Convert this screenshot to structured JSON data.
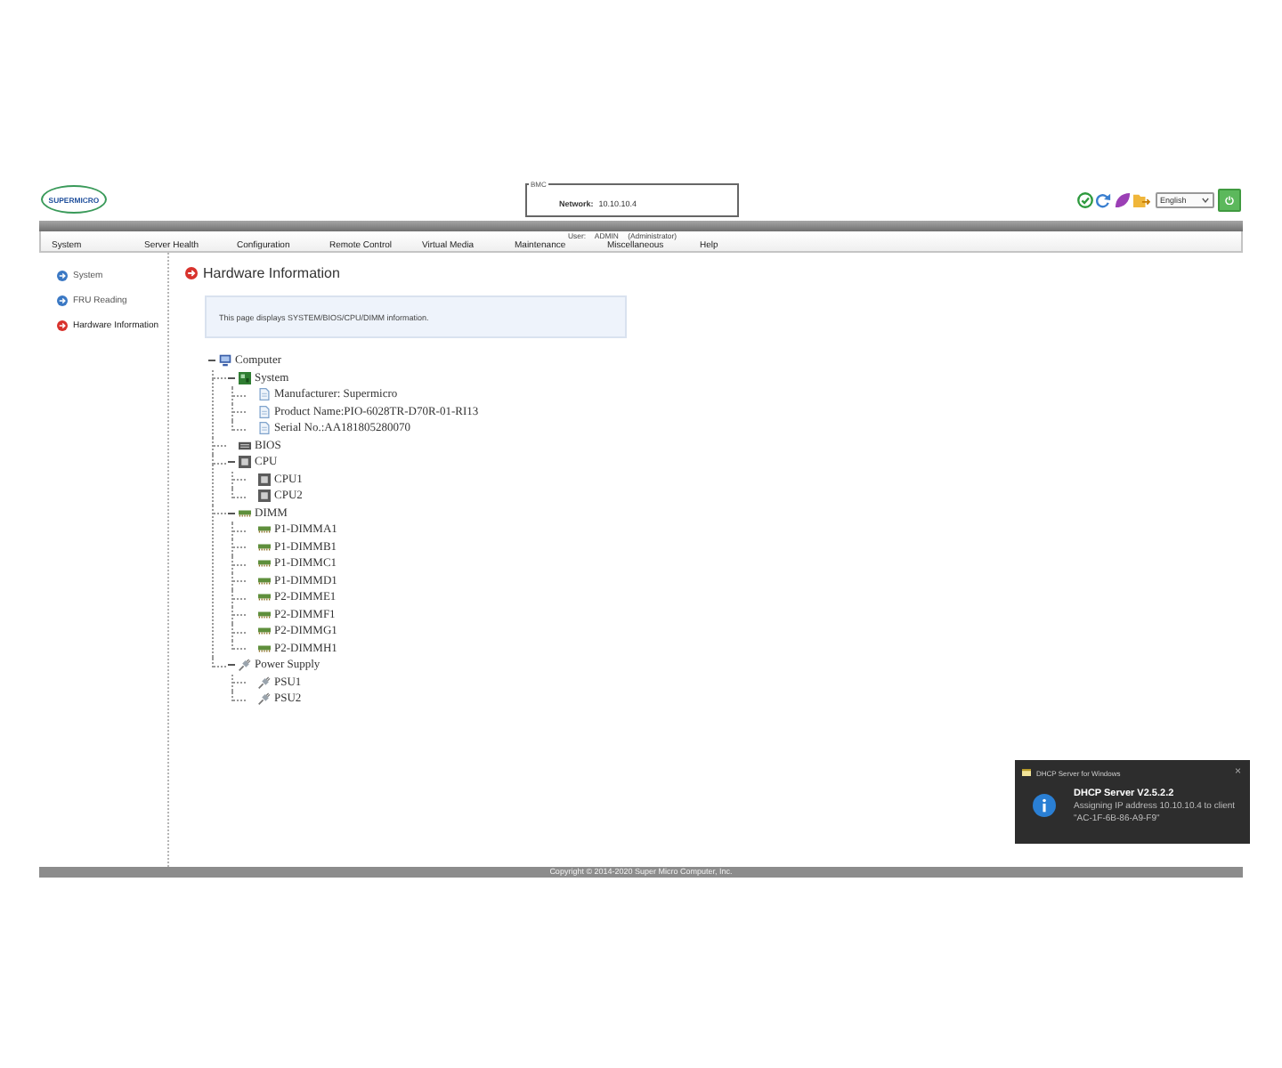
{
  "header": {
    "logo": "SUPERMICRO",
    "bmc_panel": {
      "legend": "BMC",
      "network_label": "Network:",
      "network_value": "10.10.10.4"
    },
    "language_select": {
      "value": "English"
    }
  },
  "menu": {
    "items": [
      "System",
      "Server Health",
      "Configuration",
      "Remote Control",
      "Virtual Media",
      "Maintenance",
      "Miscellaneous",
      "Help"
    ],
    "user_info": "User: ADMIN (Administrator)"
  },
  "sidebar": {
    "items": [
      {
        "label": "System",
        "selected": false
      },
      {
        "label": "FRU Reading",
        "selected": false
      },
      {
        "label": "Hardware Information",
        "selected": true
      }
    ]
  },
  "content": {
    "title": "Hardware Information",
    "description": "This page displays SYSTEM/BIOS/CPU/DIMM information.",
    "tree": [
      {
        "label": "Computer",
        "kind": "computer",
        "expanded": true,
        "children": [
          {
            "label": "System",
            "kind": "board",
            "expanded": true,
            "children": [
              {
                "label": "Manufacturer: Supermicro",
                "kind": "info"
              },
              {
                "label": "Product Name:PIO-6028TR-D70R-01-RI13",
                "kind": "info"
              },
              {
                "label": "Serial No.:AA181805280070",
                "kind": "info"
              }
            ]
          },
          {
            "label": "BIOS",
            "kind": "bios"
          },
          {
            "label": "CPU",
            "kind": "chip",
            "expanded": true,
            "children": [
              {
                "label": "CPU1",
                "kind": "chip"
              },
              {
                "label": "CPU2",
                "kind": "chip"
              }
            ]
          },
          {
            "label": "DIMM",
            "kind": "memory",
            "expanded": true,
            "children": [
              {
                "label": "P1-DIMMA1",
                "kind": "memory"
              },
              {
                "label": "P1-DIMMB1",
                "kind": "memory"
              },
              {
                "label": "P1-DIMMC1",
                "kind": "memory"
              },
              {
                "label": "P1-DIMMD1",
                "kind": "memory"
              },
              {
                "label": "P2-DIMME1",
                "kind": "memory"
              },
              {
                "label": "P2-DIMMF1",
                "kind": "memory"
              },
              {
                "label": "P2-DIMMG1",
                "kind": "memory"
              },
              {
                "label": "P2-DIMMH1",
                "kind": "memory"
              }
            ]
          },
          {
            "label": "Power Supply",
            "kind": "plug",
            "expanded": true,
            "children": [
              {
                "label": "PSU1",
                "kind": "plug"
              },
              {
                "label": "PSU2",
                "kind": "plug"
              }
            ]
          }
        ]
      }
    ]
  },
  "notification": {
    "app": "DHCP Server for Windows",
    "close": "×",
    "title": "DHCP Server V2.5.2.2",
    "message": "Assigning IP address 10.10.10.4 to client \"AC-1F-6B-86-A9-F9\""
  },
  "footer": {
    "copyright": "Copyright © 2014-2020 Super Micro Computer, Inc."
  }
}
